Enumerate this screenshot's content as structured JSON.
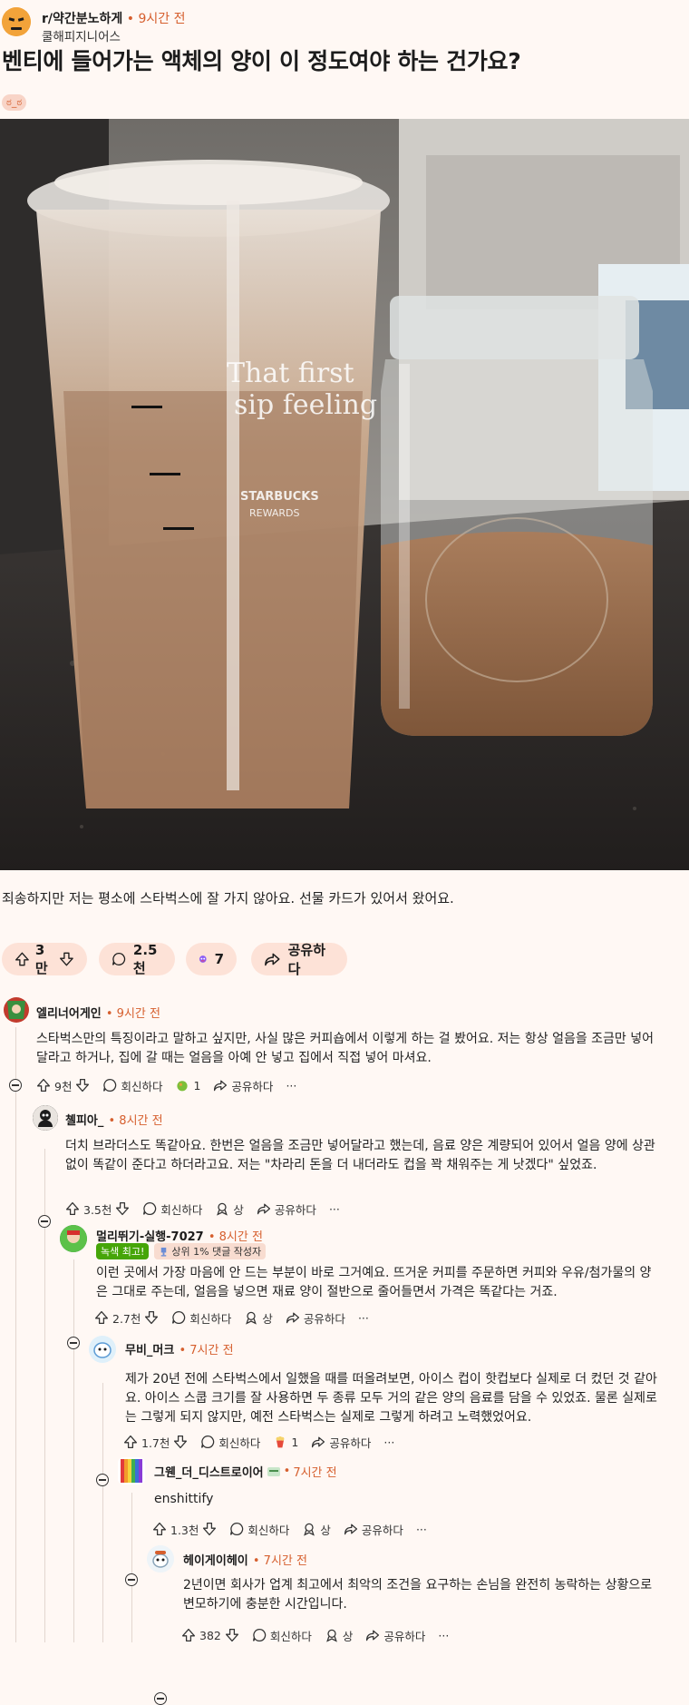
{
  "post": {
    "subreddit": "r/약간분노하게",
    "time": "9시간 전",
    "author": "쿨해피지니어스",
    "title": "벤티에 들어가는 액체의 양이 이 정도여야 하는 건가요?",
    "flair_emoji": "ಠ_ಠ",
    "body": "죄송하지만 저는 평소에 스타벅스에 잘 가지 않아요. 선물 카드가 있어서 왔어요.",
    "image_cup_text": [
      "That first",
      "sip feeling",
      "STARBUCKS",
      "REWARDS"
    ],
    "upvotes": "3만",
    "comments": "2.5천",
    "award_count": "7",
    "share": "공유하다"
  },
  "labels": {
    "reply": "회신하다",
    "share": "공유하다",
    "award": "상",
    "more": "···"
  },
  "comments": [
    {
      "user": "엘리너어게인",
      "time": "9시간 전",
      "text": "스타벅스만의 특징이라고 말하고 싶지만, 사실 많은 커피숍에서 이렇게 하는 걸 봤어요. 저는 항상 얼음을 조금만 넣어달라고 하거나, 집에 갈 때는 얼음을 아예 안 넣고 집에서 직접 넣어 마셔요.",
      "votes": "9천",
      "award_count": "1"
    },
    {
      "user": "쳴피아_",
      "time": "8시간 전",
      "text": "더치 브라더스도 똑같아요. 한번은 얼음을 조금만 넣어달라고 했는데, 음료 양은 계량되어 있어서 얼음 양에 상관없이 똑같이 준다고 하더라고요. 저는 \"차라리 돈을 더 내더라도 컵을 꽉 채워주는 게 낫겠다\" 싶었죠.",
      "votes": "3.5천"
    },
    {
      "user": "멀리뛰기-실행-7027",
      "time": "8시간 전",
      "badge1": "녹색 최고!",
      "badge2": "상위 1% 댓글 작성자",
      "text": "이런 곳에서 가장 마음에 안 드는 부분이 바로 그거예요. 뜨거운 커피를 주문하면 커피와 우유/첨가물의 양은 그대로 주는데, 얼음을 넣으면 재료 양이 절반으로 줄어들면서 가격은 똑같다는 거죠.",
      "votes": "2.7천"
    },
    {
      "user": "무비_머크",
      "time": "7시간 전",
      "text": "제가 20년 전에 스타벅스에서 일했을 때를 떠올려보면, 아이스 컵이 핫컵보다 실제로 더 컸던 것 같아요. 아이스 스쿱 크기를 잘 사용하면 두 종류 모두 거의 같은 양의 음료를 담을 수 있었죠. 물론 실제로는 그렇게 되지 않지만, 예전 스타벅스는 실제로 그렇게 하려고 노력했었어요.",
      "votes": "1.7천",
      "award_count": "1"
    },
    {
      "user": "그웬_더_디스트로이어",
      "time": "7시간 전",
      "text": "enshittify",
      "votes": "1.3천"
    },
    {
      "user": "헤이게이헤이",
      "time": "7시간 전",
      "text": "2년이면 회사가 업계 최고에서 최악의 조건을 요구하는 손님을 완전히 농락하는 상황으로 변모하기에 충분한 시간입니다.",
      "votes": "382"
    }
  ],
  "colors": {
    "accent": "#d65f2e",
    "pill": "#fde2d7",
    "background": "#fff8f4",
    "green_badge": "#46a508"
  }
}
